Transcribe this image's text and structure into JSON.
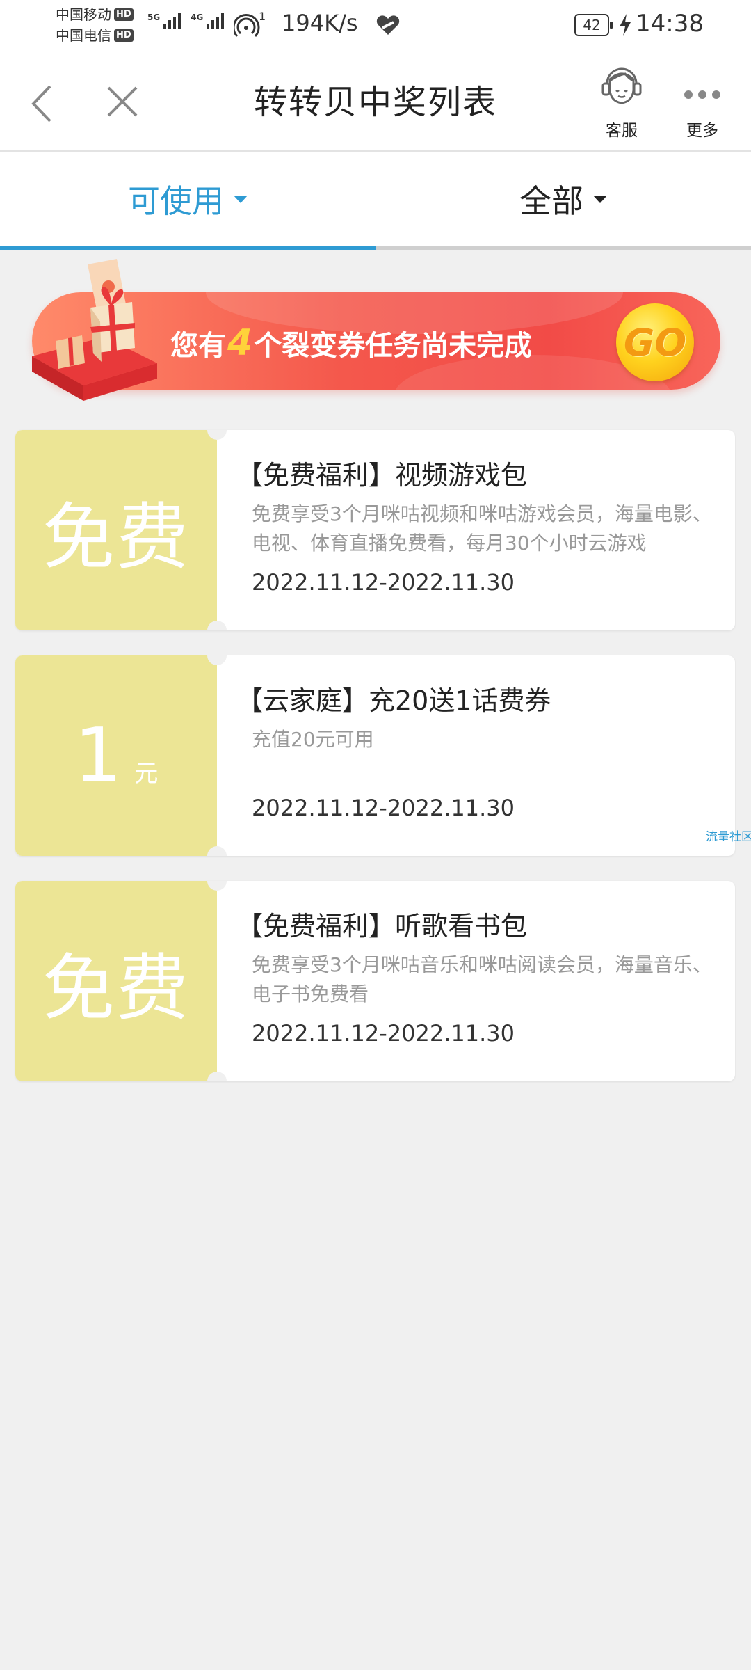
{
  "status_bar": {
    "carrier_1": "中国移动",
    "carrier_2": "中国电信",
    "hd_badge": "HD",
    "network_1": "5G",
    "network_2": "4G",
    "hotspot_count": "1",
    "net_speed": "194K/s",
    "battery_level": "42",
    "time": "14:38"
  },
  "nav": {
    "title": "转转贝中奖列表",
    "service_label": "客服",
    "more_label": "更多"
  },
  "tabs": [
    {
      "label": "可使用",
      "active": true
    },
    {
      "label": "全部",
      "active": false
    }
  ],
  "banner": {
    "text_before": "您有",
    "count": "4",
    "text_after": "个裂变券任务尚未完成",
    "go_label": "GO"
  },
  "coupons": [
    {
      "face": "免费",
      "title": "【免费福利】视频游戏包",
      "description": "免费享受3个月咪咕视频和咪咕游戏会员，海量电影、电视、体育直播免费看，每月30个小时云游戏",
      "date_range": "2022.11.12-2022.11.30"
    },
    {
      "face_amount": "1",
      "face_unit": "元",
      "title": "【云家庭】充20送1话费券",
      "description": "充值20元可用",
      "date_range": "2022.11.12-2022.11.30"
    },
    {
      "face": "免费",
      "title": "【免费福利】听歌看书包",
      "description": "免费享受3个月咪咕音乐和咪咕阅读会员，海量音乐、电子书免费看",
      "date_range": "2022.11.12-2022.11.30"
    }
  ],
  "watermark": "流量社区",
  "colors": {
    "accent": "#2e9bd3",
    "coupon_face_bg": "#ece595",
    "banner_red": "#f24b47",
    "banner_count": "#ffd23a",
    "page_bg": "#f0f0f0"
  }
}
